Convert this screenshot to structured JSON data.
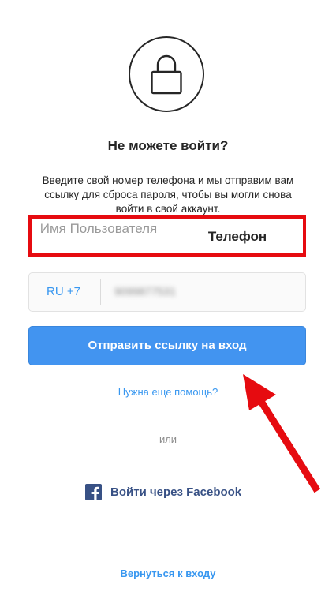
{
  "title": "Не можете войти?",
  "description": "Введите свой номер телефона и мы отправим вам ссылку для сброса пароля, чтобы вы могли снова войти в свой аккаунт.",
  "tabs": {
    "username": "Имя Пользователя",
    "phone": "Телефон",
    "active": "phone"
  },
  "phone_field": {
    "country_code": "RU +7",
    "value": "9099877531"
  },
  "send_button": "Отправить ссылку на вход",
  "help_link": "Нужна еще помощь?",
  "or_text": "или",
  "facebook_login": "Войти через Facebook",
  "back_link": "Вернуться к входу",
  "icons": {
    "lock": "lock-icon",
    "facebook": "facebook-icon",
    "annotation_arrow": "arrow-icon"
  },
  "colors": {
    "accent": "#3897f0",
    "button": "#4294f0",
    "facebook": "#385185",
    "highlight": "#e60b10"
  }
}
